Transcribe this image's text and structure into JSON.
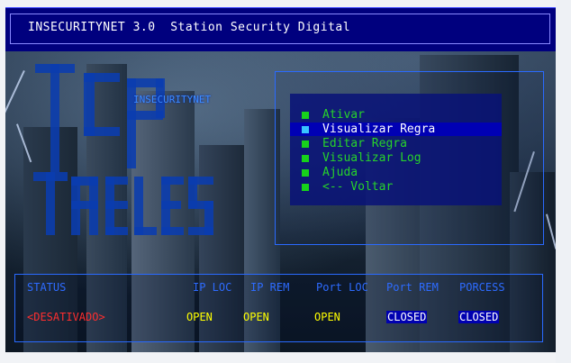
{
  "app": {
    "title": "INSECURITYNET 3.0  Station Security Digital"
  },
  "logo": {
    "small_text": "INSECURITYNET",
    "line1": "TCP",
    "line2": "TABLES"
  },
  "menu": {
    "items": [
      {
        "label": "Ativar",
        "selected": false
      },
      {
        "label": "Visualizar Regra",
        "selected": true
      },
      {
        "label": "Editar Regra",
        "selected": false
      },
      {
        "label": "Visualizar Log",
        "selected": false
      },
      {
        "label": "Ajuda",
        "selected": false
      },
      {
        "label": "<-- Voltar",
        "selected": false
      }
    ]
  },
  "status": {
    "headers": [
      "STATUS",
      "IP LOC",
      "IP REM",
      "Port LOC",
      "Port REM",
      "PORCESS"
    ],
    "values": [
      "<DESATIVADO>",
      "OPEN",
      "OPEN",
      "OPEN",
      "CLOSED",
      "CLOSED"
    ]
  },
  "colors": {
    "title_bg": "#00007e",
    "menu_text": "#27d32a",
    "header_text": "#2d6bff",
    "status_red": "#ff2e2e",
    "status_open": "#ffff00"
  }
}
